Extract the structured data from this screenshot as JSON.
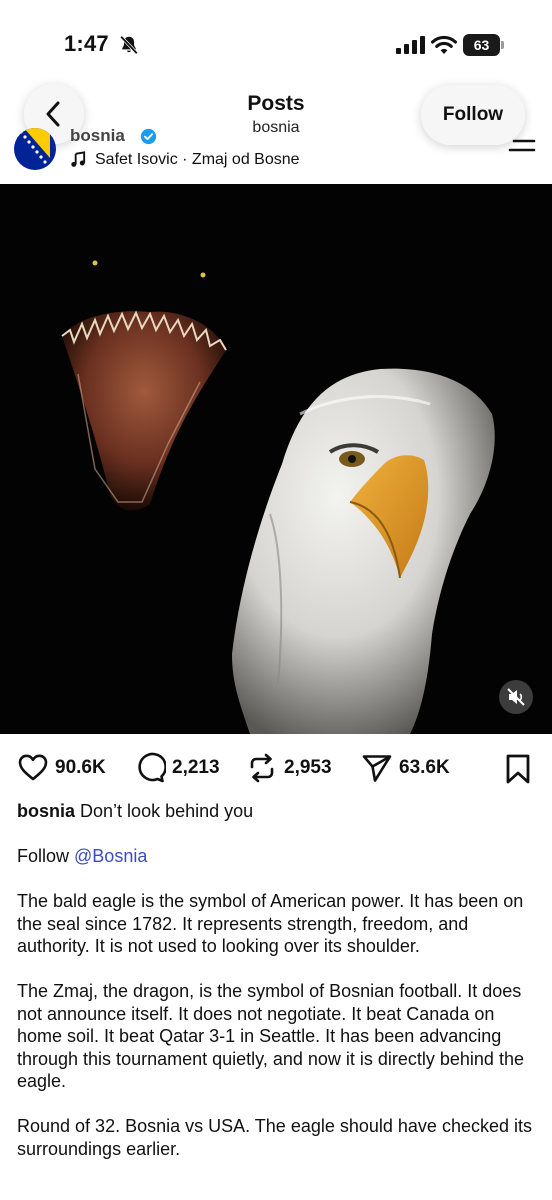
{
  "status_bar": {
    "time": "1:47",
    "battery": "63",
    "icons": [
      "bell-slash-icon",
      "cellular-signal-icon",
      "wifi-icon",
      "battery-icon"
    ]
  },
  "header": {
    "title": "Posts",
    "subtitle": "bosnia",
    "follow_label": "Follow",
    "icons": [
      "chevron-left-icon",
      "menu-lines-icon"
    ]
  },
  "post": {
    "username": "bosnia",
    "verified": true,
    "audio": "Safet Isovic · Zmaj od Bosne",
    "media_icons": [
      "speaker-muted-icon"
    ]
  },
  "actions": {
    "likes": "90.6K",
    "comments": "2,213",
    "reposts": "2,953",
    "shares": "63.6K",
    "icons": [
      "heart-icon",
      "comment-icon",
      "repost-icon",
      "send-icon",
      "bookmark-icon"
    ]
  },
  "caption": {
    "user": "bosnia",
    "headline": "Don’t look behind you",
    "follow_prefix": "Follow",
    "mention": "@Bosnia",
    "para1": "The bald eagle is the symbol of American power. It has been on the seal since 1782. It represents strength, freedom, and authority. It is not used to looking over its shoulder.",
    "para2": "The Zmaj, the dragon, is the symbol of Bosnian football. It does not announce itself. It does not negotiate. It beat Canada on home soil. It beat Qatar 3-1 in Seattle. It has been advancing through this tournament quietly, and now it is directly behind the eagle.",
    "para3": "Round of 32. Bosnia vs USA. The eagle should have checked its surroundings earlier."
  },
  "colors": {
    "mention": "#3b4cc0",
    "verified": "#1d9bf0",
    "flag_blue": "#002395",
    "flag_yellow": "#fecb00"
  }
}
